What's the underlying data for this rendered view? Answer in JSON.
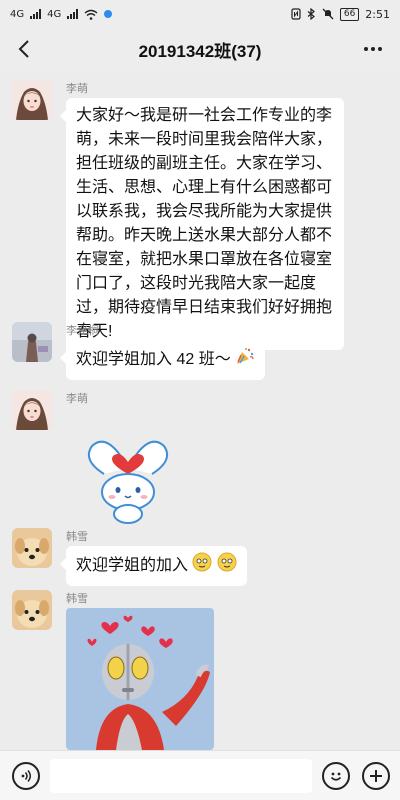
{
  "status_bar": {
    "signal_1": "4G",
    "signal_2": "4G",
    "battery": "66",
    "time": "2:51"
  },
  "header": {
    "title": "20191342班(37)"
  },
  "messages": [
    {
      "sender": "李萌",
      "text": "大家好～我是研一社会工作专业的李萌，未来一段时间里我会陪伴大家，担任班级的副班主任。大家在学习、生活、思想、心理上有什么困惑都可以联系我，我会尽我所能为大家提供帮助。昨天晚上送水果大部分人都不在寝室，就把水果口罩放在各位寝室门口了，这段时光我陪大家一起度过，期待疫情早日结束我们好好拥抱春天!"
    },
    {
      "sender": "李兆桐",
      "text": "欢迎学姐加入 42 班～",
      "emoji": "party-popper"
    },
    {
      "sender": "李萌",
      "sticker": "cinnamoroll-heart-sticker"
    },
    {
      "sender": "韩雪",
      "text": "欢迎学姐的加入",
      "emoji": "smiling-faces"
    },
    {
      "sender": "韩雪",
      "sticker": "ultraman-hearts-sticker"
    }
  ],
  "input_bar": {
    "voice_icon": "voice-icon",
    "emoji_icon": "emoji-icon",
    "plus_icon": "plus-icon"
  }
}
